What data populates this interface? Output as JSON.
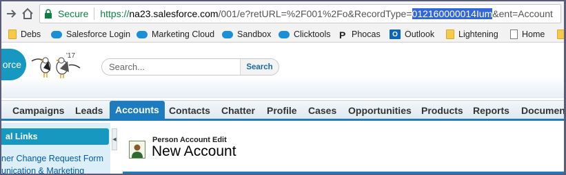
{
  "browser": {
    "security_label": "Secure",
    "url": {
      "scheme": "https://",
      "host": "na23.salesforce.com",
      "path": "/001/e?retURL=%2F001%2Fo&RecordType=",
      "selected": "012160000014Ium",
      "tail": "&ent=Account"
    },
    "bookmarks": [
      {
        "label": "Debs",
        "icon": "folder-icon"
      },
      {
        "label": "Salesforce Login",
        "icon": "salesforce-cloud-icon"
      },
      {
        "label": "Marketing Cloud",
        "icon": "salesforce-cloud-icon"
      },
      {
        "label": "Sandbox",
        "icon": "salesforce-cloud-icon"
      },
      {
        "label": "Clicktools",
        "icon": "salesforce-cloud-icon"
      },
      {
        "label": "Phocas",
        "icon": "phocas-icon"
      },
      {
        "label": "Outlook",
        "icon": "outlook-icon"
      },
      {
        "label": "Lightening",
        "icon": "folder-icon"
      },
      {
        "label": "Home",
        "icon": "page-icon"
      }
    ]
  },
  "header": {
    "logo_text": "orce",
    "mascot_badge": "'17",
    "search": {
      "placeholder": "Search...",
      "button_label": "Search"
    }
  },
  "tabs": [
    {
      "label": "Campaigns",
      "active": false
    },
    {
      "label": "Leads",
      "active": false
    },
    {
      "label": "Accounts",
      "active": true
    },
    {
      "label": "Contacts",
      "active": false
    },
    {
      "label": "Chatter",
      "active": false
    },
    {
      "label": "Profile",
      "active": false
    },
    {
      "label": "Cases",
      "active": false
    },
    {
      "label": "Opportunities",
      "active": false
    },
    {
      "label": "Products",
      "active": false
    },
    {
      "label": "Reports",
      "active": false
    },
    {
      "label": "Documents",
      "active": false
    }
  ],
  "sidebar": {
    "header": "al Links",
    "links": [
      "ner Change Request Form",
      "unication & Marketing"
    ]
  },
  "page": {
    "type": "Person Account Edit",
    "title": "New Account"
  },
  "colors": {
    "accent": "#1d7bbf",
    "secure": "#0b8043",
    "selection": "#3367d6",
    "brand": "#1798c1"
  }
}
